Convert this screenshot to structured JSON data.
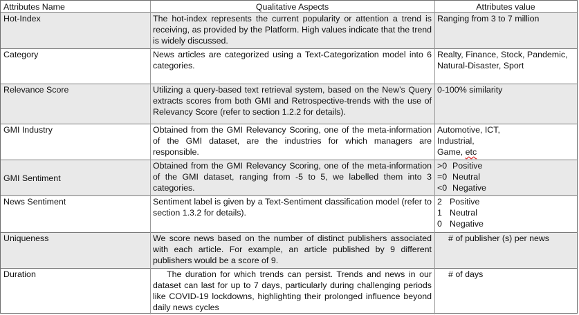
{
  "headers": {
    "col1": "Attributes Name",
    "col2": "Qualitative Aspects",
    "col3": "Attributes value"
  },
  "rows": [
    {
      "name": "Hot-Index",
      "description": "The hot-index represents the current popularity or attention a trend is receiving, as provided by the Platform. High values indicate that the trend is widely discussed.",
      "value": "Ranging from 3 to 7 million"
    },
    {
      "name": "Category",
      "description": "News articles are categorized using a Text-Categorization model into 6 categories.",
      "value": "Realty, Finance, Stock, Pandemic, Natural-Disaster, Sport"
    },
    {
      "name": "Relevance Score",
      "description": "Utilizing a query-based text retrieval system, based on the New’s Query extracts scores from both GMI and Retrospective-trends with the use of Relevancy Score (refer to section 1.2.2 for details).",
      "value": "0-100% similarity"
    },
    {
      "name": "GMI Industry",
      "description": "Obtained from the GMI Relevancy Scoring, one of the meta-information of the GMI dataset, are the industries for which managers are responsible.",
      "value_lines": [
        "Automotive, ICT,",
        "Industrial,",
        "Game, "
      ],
      "value_etc": "etc"
    },
    {
      "name": "GMI Sentiment",
      "description": "Obtained from the GMI Relevancy Scoring, one of the meta-information of the GMI dataset, ranging from -5 to 5, we labelled them into 3 categories.",
      "value_items": [
        {
          "sym": ">0",
          "label": "Positive"
        },
        {
          "sym": "=0",
          "label": "Neutral"
        },
        {
          "sym": "<0",
          "label": "Negative"
        }
      ]
    },
    {
      "name": "News Sentiment",
      "description": "Sentiment label is given by a Text-Sentiment classification model (refer to section 1.3.2 for details).",
      "value_items": [
        {
          "sym": "2",
          "label": "Positive"
        },
        {
          "sym": "1",
          "label": "Neutral"
        },
        {
          "sym": "0",
          "label": "Negative"
        }
      ]
    },
    {
      "name": "Uniqueness",
      "description": "We score news based on the number of distinct publishers associated with each article. For example, an article published by 9 different publishers would be a score of 9.",
      "value": "# of publisher (s) per news"
    },
    {
      "name": "Duration",
      "description": "The duration for which trends can persist. Trends and news in our dataset can last for up to 7 days, particularly during challenging periods like COVID-19 lockdowns, highlighting their prolonged influence beyond daily news cycles",
      "value": "# of days"
    }
  ]
}
